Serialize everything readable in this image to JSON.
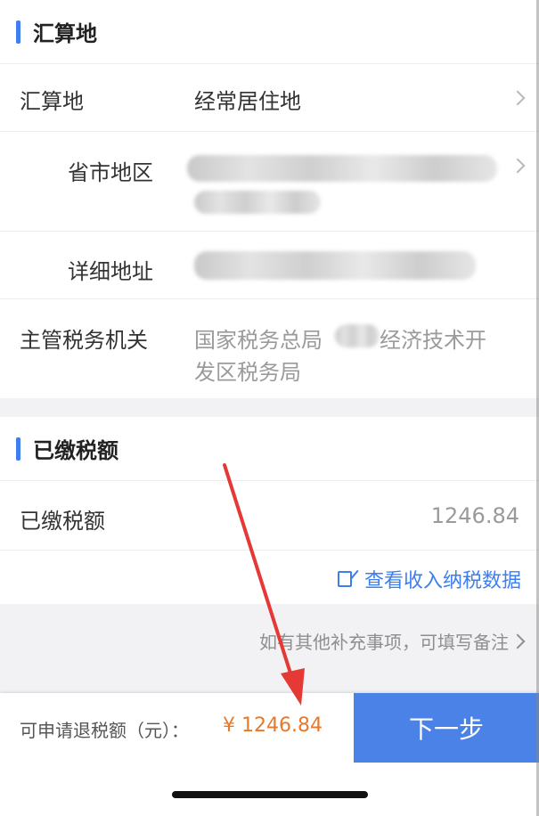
{
  "section1": {
    "title": "汇算地",
    "rows": {
      "location_label": "汇算地",
      "location_value": "经常居住地",
      "region_label": "省市地区",
      "address_label": "详细地址",
      "tax_office_label": "主管税务机关",
      "tax_office_value_line1": "国家税务总局",
      "tax_office_value_line1b": "经济技术开",
      "tax_office_value_line2": "发区税务局"
    }
  },
  "section2": {
    "title": "已缴税额",
    "paid_label": "已缴税额",
    "paid_value": "1246.84",
    "view_link": "查看收入纳税数据"
  },
  "note": {
    "text": "如有其他补充事项，可填写备注"
  },
  "footer": {
    "refund_label": "可申请退税额（元）：",
    "refund_amount": "¥ 1246.84",
    "next_button": "下一步"
  },
  "colors": {
    "accent": "#3d7ef0",
    "button": "#4a82e8",
    "amount": "#e8792b",
    "annotation_arrow": "#e53935"
  },
  "icons": [
    "chevron-right-icon",
    "edit-icon"
  ]
}
